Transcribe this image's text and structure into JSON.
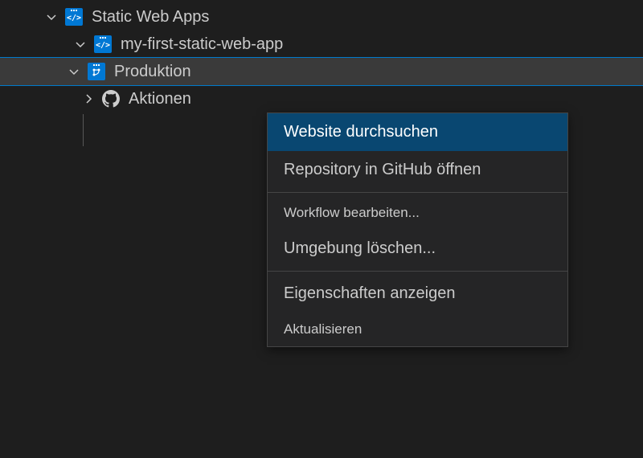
{
  "tree": {
    "root": {
      "label": "Static Web Apps"
    },
    "app": {
      "label": "my-first-static-web-app"
    },
    "env": {
      "label": "Produktion"
    },
    "actions": {
      "label": "Aktionen"
    }
  },
  "contextMenu": {
    "items": [
      {
        "label": "Website durchsuchen",
        "highlighted": true
      },
      {
        "label": "Repository in GitHub öffnen"
      },
      {
        "label": "Workflow bearbeiten...",
        "small": true
      },
      {
        "label": "Umgebung löschen..."
      },
      {
        "label": "Eigenschaften anzeigen"
      },
      {
        "label": "Aktualisieren",
        "small": true
      }
    ]
  }
}
